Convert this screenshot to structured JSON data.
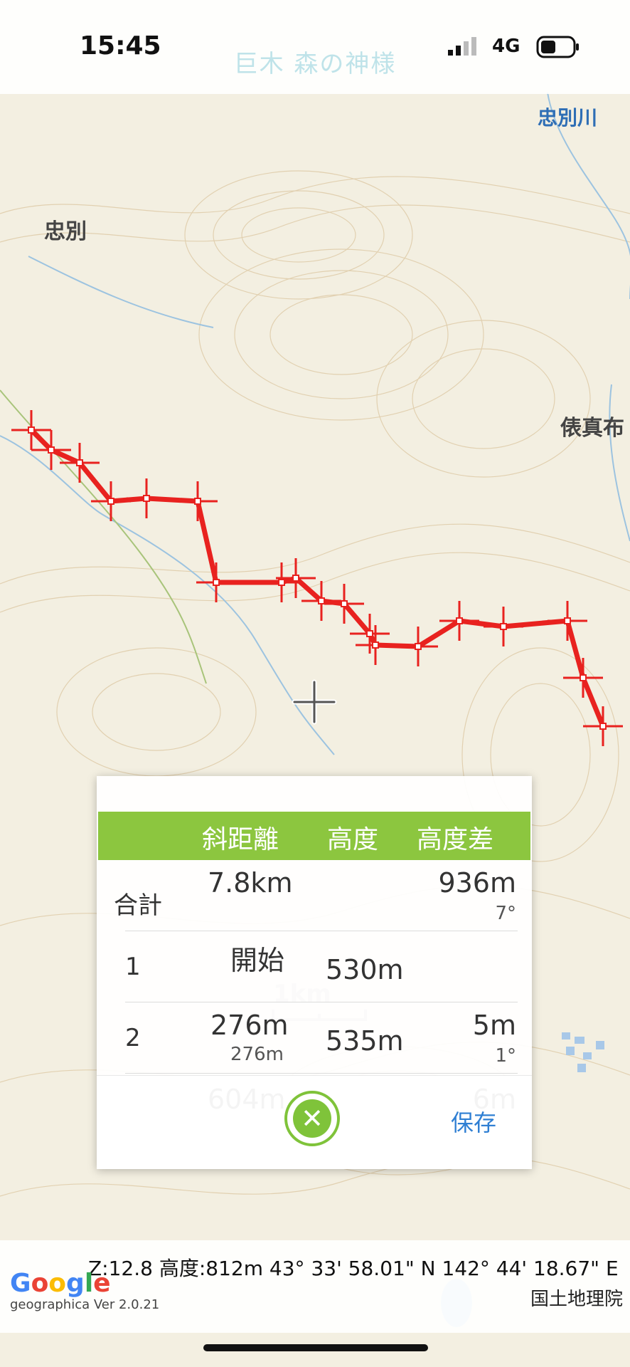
{
  "status_bar": {
    "time": "15:45",
    "network": "4G"
  },
  "map": {
    "title": "巨木 森の神様",
    "places": [
      "忠別",
      "俵真布",
      "忠別川"
    ]
  },
  "route": {
    "color": "#e8221f"
  },
  "panel": {
    "headers": [
      "斜距離",
      "高度",
      "高度差"
    ],
    "header_color": "#8cc63f",
    "rows": [
      {
        "label": "合計",
        "distance": "7.8km",
        "distance_sub": "",
        "altitude": "",
        "diff": "936m",
        "diff_sub": "7°"
      },
      {
        "label": "1",
        "distance": "開始",
        "distance_sub": "",
        "altitude": "530m",
        "diff": "",
        "diff_sub": ""
      },
      {
        "label": "2",
        "distance": "276m",
        "distance_sub": "276m",
        "altitude": "535m",
        "diff": "5m",
        "diff_sub": "1°"
      },
      {
        "label": "",
        "distance": "604m",
        "distance_sub": "",
        "altitude": "",
        "diff": "6m",
        "diff_sub": ""
      }
    ],
    "save_label": "保存",
    "close_icon": "close-icon"
  },
  "scale": {
    "label": "1km"
  },
  "footer": {
    "coords": "Z:12.8 高度:812m  43° 33' 58.01\" N 142° 44' 18.67\" E",
    "attribution": "国土地理院",
    "google": "Google",
    "version": "geographica Ver 2.0.21"
  }
}
